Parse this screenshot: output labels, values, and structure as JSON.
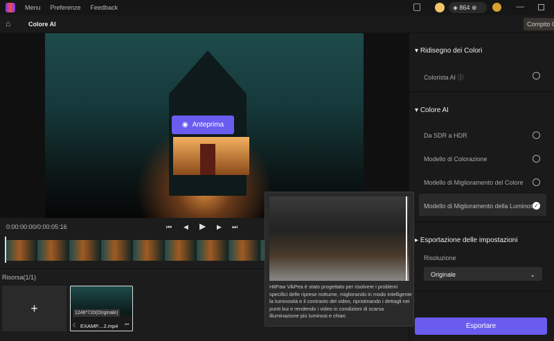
{
  "menu": {
    "items": [
      "Menu",
      "Preferenze",
      "Feedback"
    ],
    "credits": "864"
  },
  "header": {
    "title": "Colore AI",
    "task_button": "Compito C"
  },
  "preview": {
    "button": "Anteprima"
  },
  "player": {
    "time": "0:00:00:00/0:00:05:16"
  },
  "resources": {
    "title": "Risorsa(1/1)",
    "add": "+",
    "file": {
      "resolution": "1248*720(Originale)",
      "name": "EXAMP....2.mp4",
      "more": "•••"
    }
  },
  "panel": {
    "sections": [
      {
        "title": "Ridisegno dei Colori",
        "options": [
          {
            "label": "Colorista AI",
            "selected": false
          }
        ]
      },
      {
        "title": "Colore AI",
        "options": [
          {
            "label": "Da SDR a HDR",
            "selected": false
          },
          {
            "label": "Modello di Colorazione",
            "selected": false
          },
          {
            "label": "Modello di Miglioramento del Colore",
            "selected": false
          },
          {
            "label": "Modello di Miglioramento della Luminosità",
            "selected": true
          }
        ]
      },
      {
        "title": "Esportazione delle impostazioni"
      }
    ],
    "resolution_label": "Risoluzione",
    "resolution_value": "Originale",
    "export": "Esportare"
  },
  "tooltip": {
    "text": "HitPaw VikPea è stato progettato per risolvere i problemi specifici delle riprese notturne, migliorando in modo intelligente la luminosità e il contrasto del video, ripristinando i dettagli nei punti bui e rendendo i video in condizioni di scarsa illuminazione più luminosi e chiari."
  },
  "colors": {
    "accent": "#6b5cf0"
  }
}
